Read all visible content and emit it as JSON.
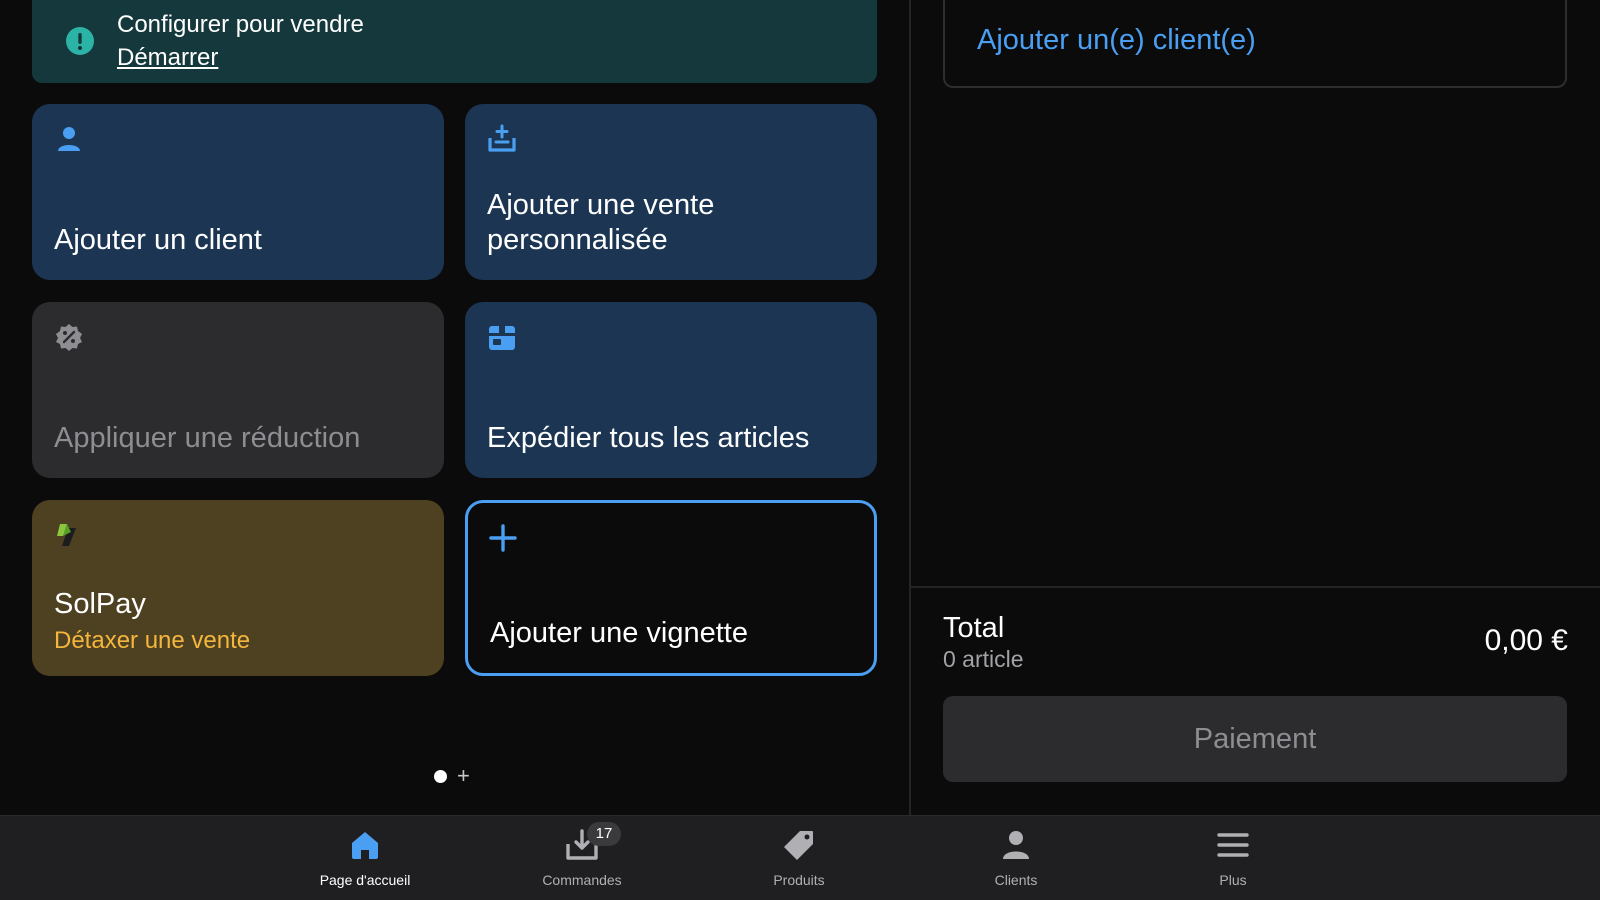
{
  "banner": {
    "title": "Configurer pour vendre",
    "link": "Démarrer"
  },
  "tiles": {
    "add_customer": "Ajouter un client",
    "custom_sale": "Ajouter une vente personnalisée",
    "apply_discount": "Appliquer une réduction",
    "ship_all": "Expédier tous les articles",
    "solpay_title": "SolPay",
    "solpay_subtitle": "Détaxer une vente",
    "add_tile": "Ajouter une vignette"
  },
  "cart": {
    "add_customer_link": "Ajouter un(e) client(e)",
    "total_label": "Total",
    "item_count": "0 article",
    "total_amount": "0,00 €",
    "pay_button": "Paiement"
  },
  "nav": {
    "items": [
      {
        "label": "Page d'accueil",
        "icon": "home-icon",
        "active": true
      },
      {
        "label": "Commandes",
        "icon": "orders-icon",
        "badge": "17"
      },
      {
        "label": "Produits",
        "icon": "tag-icon"
      },
      {
        "label": "Clients",
        "icon": "person-icon"
      },
      {
        "label": "Plus",
        "icon": "menu-icon"
      }
    ]
  },
  "colors": {
    "accent": "#4a9ff2",
    "tile_blue": "#1b3553",
    "tile_gold": "#4e4122",
    "gold_text": "#f4b63c",
    "banner_bg": "#15383d",
    "banner_icon": "#2bb3a6"
  }
}
